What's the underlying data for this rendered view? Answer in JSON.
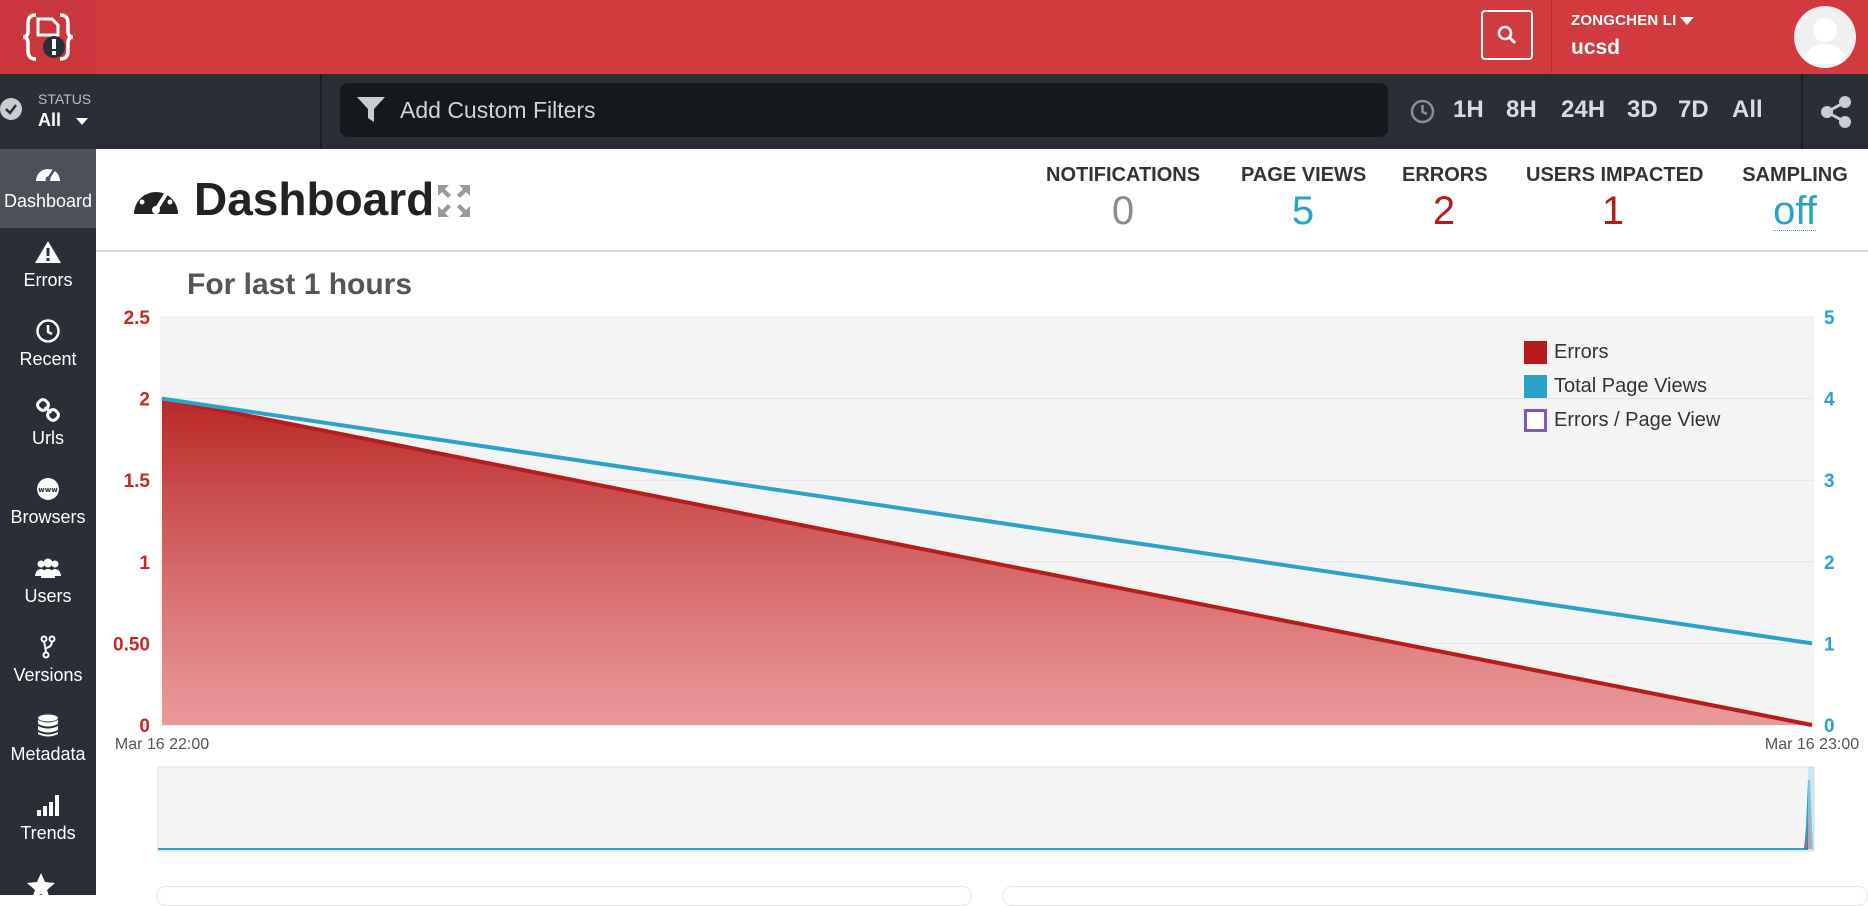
{
  "header": {
    "user_name": "ZONGCHEN LI",
    "organization": "ucsd"
  },
  "filterbar": {
    "status_label": "STATUS",
    "status_value": "All",
    "custom_filter_label": "Add Custom Filters",
    "time_ranges": [
      "1H",
      "8H",
      "24H",
      "3D",
      "7D",
      "All"
    ]
  },
  "sidebar": {
    "items": [
      {
        "label": "Dashboard",
        "icon": "gauge-icon",
        "active": true
      },
      {
        "label": "Errors",
        "icon": "warning-icon"
      },
      {
        "label": "Recent",
        "icon": "clock-icon"
      },
      {
        "label": "Urls",
        "icon": "link-icon"
      },
      {
        "label": "Browsers",
        "icon": "www-icon"
      },
      {
        "label": "Users",
        "icon": "users-icon"
      },
      {
        "label": "Versions",
        "icon": "branch-icon"
      },
      {
        "label": "Metadata",
        "icon": "database-icon"
      },
      {
        "label": "Trends",
        "icon": "bars-icon"
      }
    ]
  },
  "dashboard": {
    "title": "Dashboard",
    "stats": [
      {
        "label": "NOTIFICATIONS",
        "value": "0",
        "color": "#8c8c8c"
      },
      {
        "label": "PAGE VIEWS",
        "value": "5",
        "color": "#2aa3c7"
      },
      {
        "label": "ERRORS",
        "value": "2",
        "color": "#b71c1c"
      },
      {
        "label": "USERS IMPACTED",
        "value": "1",
        "color": "#b71c1c"
      },
      {
        "label": "SAMPLING",
        "value": "off",
        "color": "#2aa3c7"
      }
    ]
  },
  "chart_data": {
    "type": "area",
    "title": "For last 1 hours",
    "x": [
      "Mar 16 22:00",
      "Mar 16 23:00"
    ],
    "series": [
      {
        "name": "Errors",
        "axis": "left",
        "values": [
          2,
          0
        ],
        "color": "#b71c1c"
      },
      {
        "name": "Total Page Views",
        "axis": "right",
        "values": [
          4,
          1
        ],
        "color": "#2aa3c7"
      },
      {
        "name": "Errors / Page View",
        "axis": "right",
        "values": [],
        "color": "#7e57c2"
      }
    ],
    "left_axis": {
      "ticks": [
        "0",
        "0.50",
        "1",
        "1.5",
        "2",
        "2.5"
      ],
      "ylim": [
        0,
        2.5
      ],
      "color": "#c62828"
    },
    "right_axis": {
      "ticks": [
        "0",
        "1",
        "2",
        "3",
        "4",
        "5"
      ],
      "ylim": [
        0,
        5
      ],
      "color": "#2aa3c7"
    },
    "legend_position": "top-right",
    "grid": true
  }
}
